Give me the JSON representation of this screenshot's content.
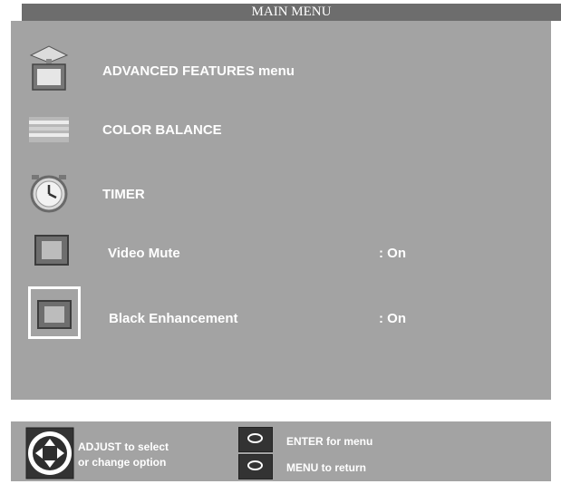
{
  "menu": {
    "title": "MAIN MENU",
    "items": [
      {
        "label": "ADVANCED FEATURES menu",
        "icon": "advanced-features-icon"
      },
      {
        "label": "COLOR BALANCE",
        "icon": "color-balance-icon"
      },
      {
        "label": "TIMER",
        "icon": "alarm-clock-icon"
      },
      {
        "label": "Video Mute",
        "value": ": On",
        "icon": "screen-icon"
      },
      {
        "label": "Black Enhancement",
        "value": ": On",
        "icon": "screen-icon",
        "selected": true
      }
    ]
  },
  "hints": {
    "adjust_line1": "ADJUST to select",
    "adjust_line2": "or  change option",
    "enter": "ENTER for menu",
    "menu": "MENU  to  return"
  },
  "colors": {
    "panel": "#a3a3a3",
    "title_bar": "#6d6d6d",
    "text": "#ffffff"
  }
}
